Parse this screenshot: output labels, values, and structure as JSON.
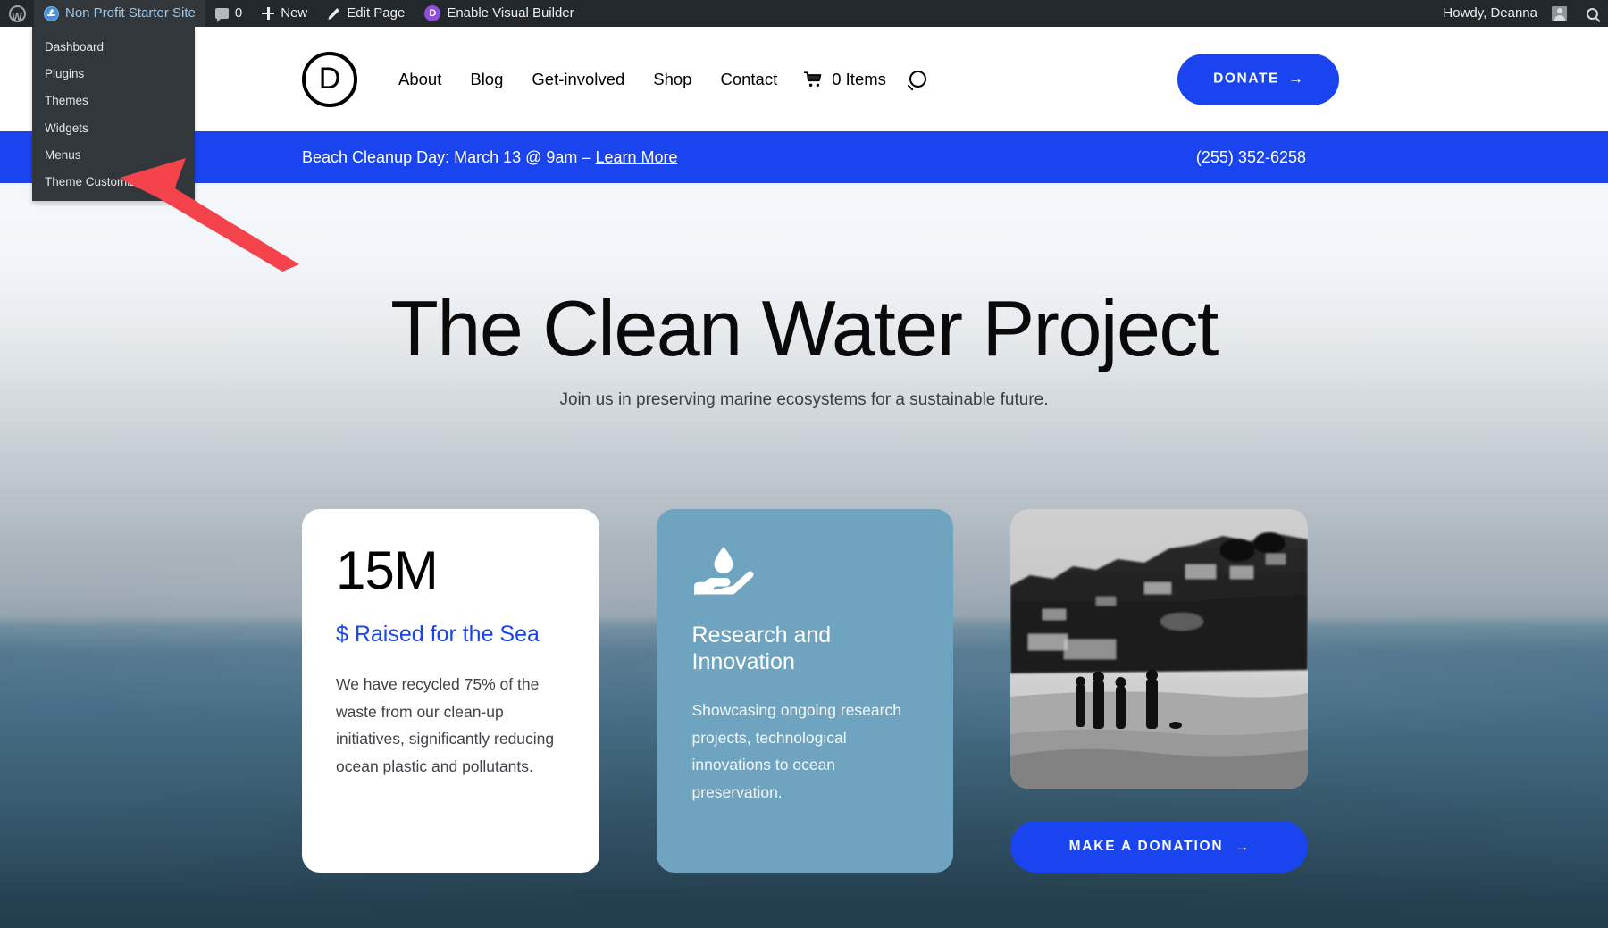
{
  "adminbar": {
    "wp_logo": "wordpress-logo-icon",
    "site_name": "Non Profit Starter Site",
    "comments_count": "0",
    "new_label": "New",
    "edit_page_label": "Edit Page",
    "divi_badge": "D",
    "visual_builder_label": "Enable Visual Builder",
    "howdy": "Howdy, Deanna",
    "bar_bg": "#23282d"
  },
  "admin_submenu": {
    "items": [
      {
        "label": "Dashboard"
      },
      {
        "label": "Plugins"
      },
      {
        "label": "Themes"
      },
      {
        "label": "Widgets"
      },
      {
        "label": "Menus"
      },
      {
        "label": "Theme Customizer"
      }
    ],
    "bg": "#32373c",
    "highlight_target": "Theme Customizer"
  },
  "annotation": {
    "arrow_color": "#f4434a",
    "points_to": "Theme Customizer"
  },
  "site_header": {
    "logo_letter": "D",
    "nav": [
      {
        "label": "About"
      },
      {
        "label": "Blog"
      },
      {
        "label": "Get-involved"
      },
      {
        "label": "Shop"
      },
      {
        "label": "Contact"
      }
    ],
    "cart_label": "0 Items",
    "search_icon": "search-icon",
    "donate_label": "DONATE",
    "donate_arrow": "→",
    "accent_blue": "#1a44f0"
  },
  "announcement": {
    "text": "Beach Cleanup Day: March 13 @ 9am – ",
    "link_label": "Learn More",
    "phone": "(255) 352-6258",
    "bg": "#1a44f0"
  },
  "hero": {
    "title": "The Clean Water Project",
    "subtitle": "Join us in preserving marine ecosystems for a sustainable future."
  },
  "cards": [
    {
      "type": "stat",
      "number": "15M",
      "label": "$ Raised for the Sea",
      "body": "We have recycled 75% of the waste from our clean-up initiatives, significantly reducing ocean plastic and pollutants.",
      "bg": "#ffffff",
      "label_color": "#1a44f0"
    },
    {
      "type": "feature",
      "icon": "hand-holding-water-drop-icon",
      "title": "Research and Innovation",
      "body": "Showcasing ongoing research projects, technological innovations to ocean preservation.",
      "bg": "#6ea4bf"
    },
    {
      "type": "image-cta",
      "image_alt": "black-and-white-beach-photo",
      "cta_label": "MAKE A DONATION",
      "cta_arrow": "→",
      "cta_bg": "#1a44f0"
    }
  ]
}
